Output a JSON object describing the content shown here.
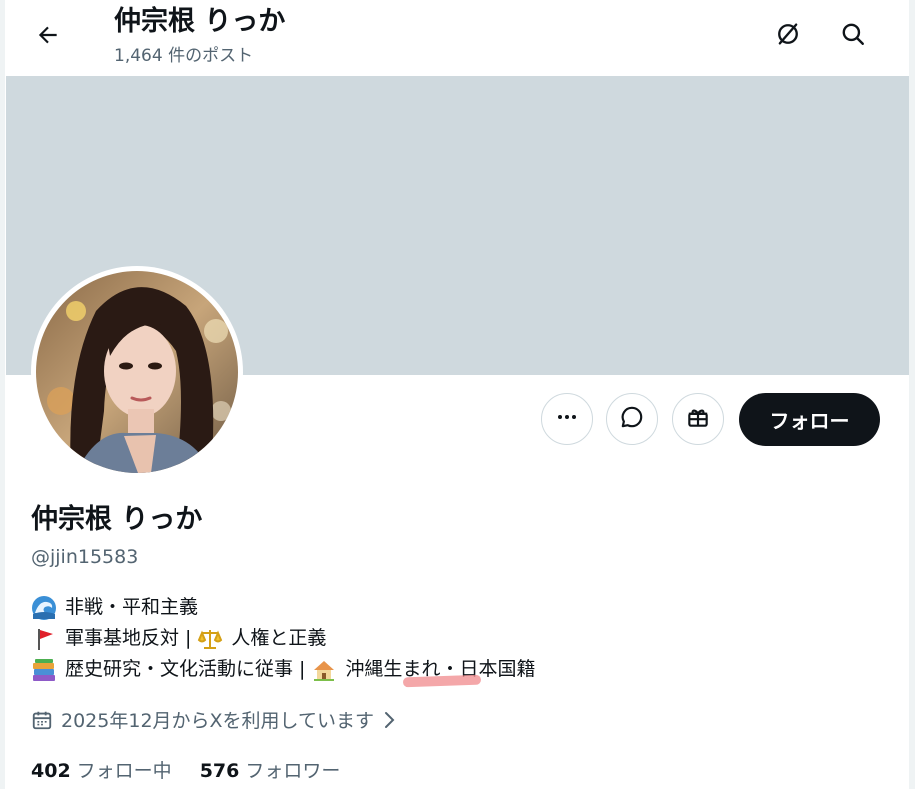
{
  "header": {
    "back_icon": "arrow-left-icon",
    "title": "仲宗根 りっか",
    "post_count": "1,464 件のポスト",
    "translate_icon": "translate-off-icon",
    "search_icon": "search-icon"
  },
  "colors": {
    "banner": "#cfd9de",
    "follow_button_bg": "#0f1419",
    "secondary_text": "#536471",
    "highlight_marker": "#f08a8c"
  },
  "actions": {
    "more_icon": "more-icon",
    "message_icon": "message-icon",
    "gift_icon": "gift-icon",
    "follow_label": "フォロー"
  },
  "profile": {
    "name": "仲宗根 りっか",
    "handle": "@jjin15583",
    "bio": {
      "line1": {
        "emoji": "wave-emoji",
        "text": "非戦・平和主義"
      },
      "line2": {
        "emoji1": "red-flag-emoji",
        "text1": "軍事基地反対",
        "separator": "|",
        "emoji2": "balance-scale-emoji",
        "text2": "人権と正義"
      },
      "line3": {
        "emoji1": "books-emoji",
        "text1": "歴史研究・文化活動に従事",
        "separator": "|",
        "emoji2": "house-emoji",
        "text2a": "沖縄生",
        "text2b": "まれ・日本国籍"
      }
    },
    "joined": "2025年12月からXを利用しています",
    "following_count": "402",
    "following_label": "フォロー中",
    "followers_count": "576",
    "followers_label": "フォロワー"
  }
}
